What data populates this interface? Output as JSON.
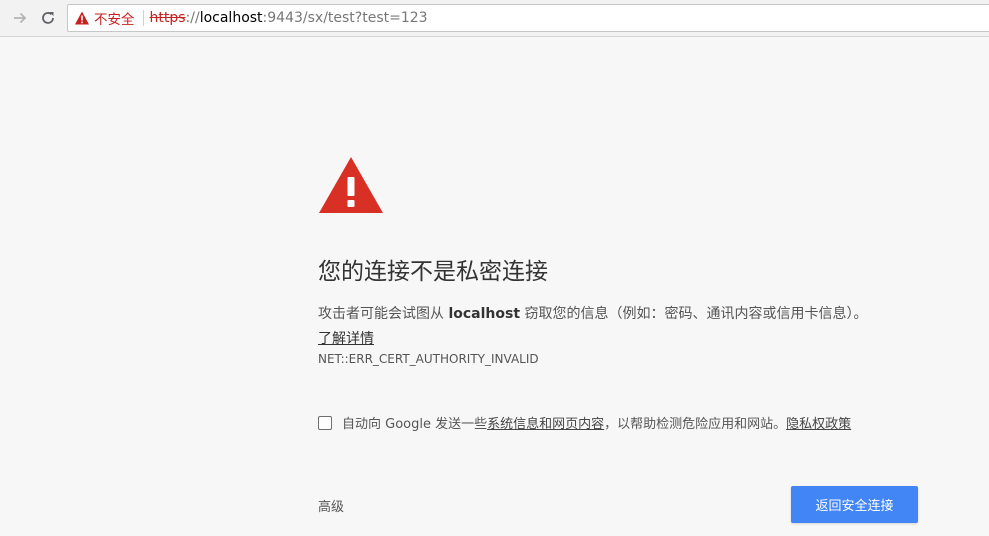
{
  "browser": {
    "security_label": "不安全",
    "url": {
      "scheme": "https",
      "separator": "://",
      "host": "localhost",
      "rest": ":9443/sx/test?test=123"
    },
    "icons": {
      "forward": "arrow-forward-icon",
      "reload": "reload-icon",
      "security": "warning-triangle-icon"
    }
  },
  "interstitial": {
    "icon": "warning-triangle-icon",
    "heading": "您的连接不是私密连接",
    "description": {
      "before": "攻击者可能会试图从 ",
      "host": "localhost",
      "after": " 窃取您的信息（例如：密码、通讯内容或信用卡信息）。"
    },
    "learn_more": "了解详情",
    "error_code": "NET::ERR_CERT_AUTHORITY_INVALID",
    "report": {
      "checked": false,
      "text_before": "自动向 Google 发送一些",
      "system_info_link": "系统信息和网页内容",
      "text_middle": "，以帮助检测危险应用和网站。",
      "privacy_link": "隐私权政策"
    },
    "advanced_label": "高级",
    "back_button_label": "返回安全连接"
  },
  "colors": {
    "danger": "#d93025",
    "accent": "#4285f4",
    "background": "#f7f7f7"
  }
}
